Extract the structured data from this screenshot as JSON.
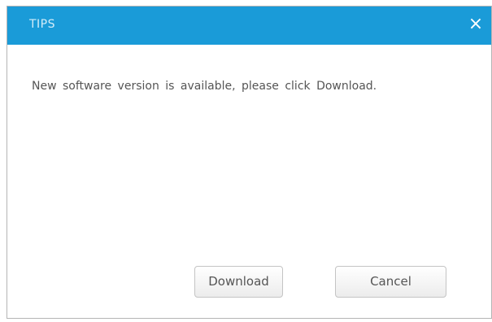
{
  "dialog": {
    "title": "TIPS",
    "close_glyph": "×",
    "message": "New software version is available, please click Download.",
    "buttons": {
      "download": "Download",
      "cancel": "Cancel"
    }
  },
  "colors": {
    "title_bar": "#1a9bd8",
    "title_text": "#d4edf9",
    "message_text": "#555555",
    "button_border": "#c4c4c4"
  },
  "icons": {
    "close": "close-icon"
  }
}
